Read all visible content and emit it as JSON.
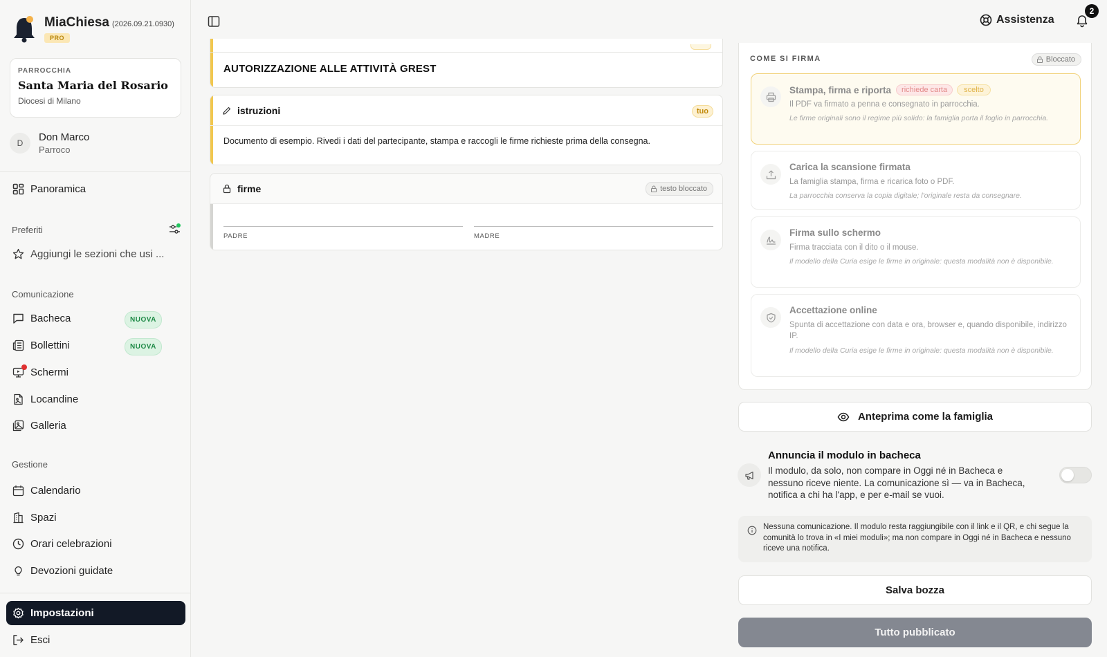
{
  "app": {
    "name": "MiaChiesa",
    "version": "(2026.09.21.0930)",
    "badge": "PRO"
  },
  "parish": {
    "label": "PARROCCHIA",
    "name": "Santa Maria del Rosario",
    "diocese": "Diocesi di Milano"
  },
  "user": {
    "initial": "D",
    "name": "Don Marco",
    "role": "Parroco"
  },
  "sidebar": {
    "overview": "Panoramica",
    "favorites_label": "Preferiti",
    "favorites_add": "Aggiungi le sezioni che usi ...",
    "communication_label": "Comunicazione",
    "communication_items": [
      "Bacheca",
      "Bollettini",
      "Schermi",
      "Locandine",
      "Galleria"
    ],
    "new_badge": "NUOVA",
    "management_label": "Gestione",
    "management_items": [
      "Calendario",
      "Spazi",
      "Orari celebrazioni",
      "Devozioni guidate"
    ],
    "settings": "Impostazioni",
    "logout": "Esci"
  },
  "topbar": {
    "assistance": "Assistenza",
    "notification_count": "2"
  },
  "document": {
    "title": "AUTORIZZAZIONE ALLE ATTIVITÀ GREST",
    "instructions_title": "istruzioni",
    "instructions_badge": "tuo",
    "instructions_body": "Documento di esempio. Rivedi i dati del partecipante, stampa e raccogli le firme richieste prima della consegna.",
    "signatures_title": "firme",
    "signatures_badge": "testo bloccato",
    "signer_1": "PADRE",
    "signer_2": "MADRE"
  },
  "sign_panel": {
    "title": "COME SI FIRMA",
    "locked": "Bloccato",
    "options": [
      {
        "title": "Stampa, firma e riporta",
        "chip_requires": "richiede carta",
        "chip_selected": "scelto",
        "desc": "Il PDF va firmato a penna e consegnato in parrocchia.",
        "note": "Le firme originali sono il regime più solido: la famiglia porta il foglio in parrocchia."
      },
      {
        "title": "Carica la scansione firmata",
        "desc": "La famiglia stampa, firma e ricarica foto o PDF.",
        "note": "La parrocchia conserva la copia digitale; l'originale resta da consegnare."
      },
      {
        "title": "Firma sullo schermo",
        "desc": "Firma tracciata con il dito o il mouse.",
        "note": "Il modello della Curia esige le firme in originale: questa modalità non è disponibile."
      },
      {
        "title": "Accettazione online",
        "desc": "Spunta di accettazione con data e ora, browser e, quando disponibile, indirizzo IP.",
        "note": "Il modello della Curia esige le firme in originale: questa modalità non è disponibile."
      }
    ]
  },
  "preview_button": "Anteprima come la famiglia",
  "announce": {
    "title": "Annuncia il modulo in bacheca",
    "desc": "Il modulo, da solo, non compare in Oggi né in Bacheca e nessuno riceve niente. La comunicazione sì — va in Bacheca, notifica a chi ha l'app, e per e-mail se vuoi.",
    "enabled": false
  },
  "info_note": "Nessuna comunicazione. Il modulo resta raggiungibile con il link e il QR, e chi segue la comunità lo trova in «I miei moduli»; ma non compare in Oggi né in Bacheca e nessuno riceve una notifica.",
  "save_button": "Salva bozza",
  "publish_button": "Tutto pubblicato",
  "colors": {
    "accent_yellow": "#f1c74f",
    "active_nav": "#121926",
    "new_badge_green": "#1f8a47",
    "publish_disabled": "#848891"
  }
}
